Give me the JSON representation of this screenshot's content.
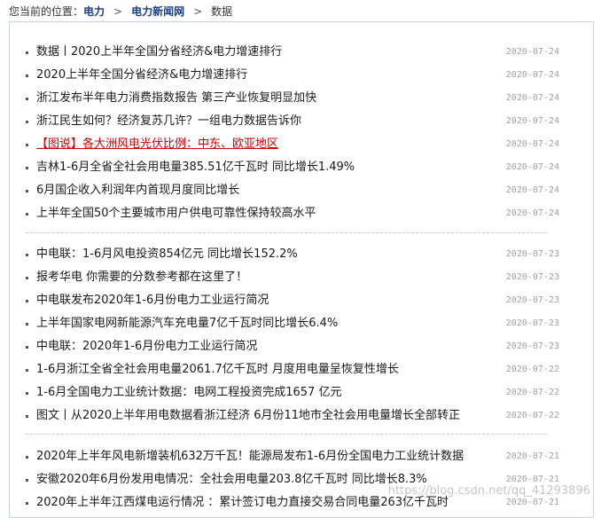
{
  "breadcrumb": {
    "prefix": "您当前的位置：",
    "items": [
      "电力",
      "电力新闻网"
    ],
    "current": "数据",
    "separator": ">"
  },
  "groups": [
    [
      {
        "title": "数据丨2020上半年全国分省经济&电力增速排行",
        "date": "2020-07-24"
      },
      {
        "title": "2020上半年全国分省经济&电力增速排行",
        "date": "2020-07-24"
      },
      {
        "title": "浙江发布半年电力消费指数报告 第三产业恢复明显加快",
        "date": "2020-07-24"
      },
      {
        "title": "浙江民生如何？经济复苏几许？一组电力数据告诉你",
        "date": "2020-07-24"
      },
      {
        "title": "【图说】各大洲风电光伏比例：中东、欧亚地区",
        "date": "2020-07-24",
        "highlight": true
      },
      {
        "title": "吉林1-6月全省全社会用电量385.51亿千瓦时 同比增长1.49%",
        "date": "2020-07-24"
      },
      {
        "title": "6月国企收入利润年内首现月度同比增长",
        "date": "2020-07-24"
      },
      {
        "title": "上半年全国50个主要城市用户供电可靠性保持较高水平",
        "date": "2020-07-24"
      }
    ],
    [
      {
        "title": "中电联：1-6月风电投资854亿元 同比增长152.2%",
        "date": "2020-07-23"
      },
      {
        "title": "报考华电 你需要的分数参考都在这里了！",
        "date": "2020-07-23"
      },
      {
        "title": "中电联发布2020年1-6月份电力工业运行简况",
        "date": "2020-07-23"
      },
      {
        "title": "上半年国家电网新能源汽车充电量7亿千瓦时同比增长6.4%",
        "date": "2020-07-23"
      },
      {
        "title": "中电联：2020年1-6月份电力工业运行简况",
        "date": "2020-07-23"
      },
      {
        "title": "1-6月浙江全省全社会用电量2061.7亿千瓦时 月度用电量呈恢复性增长",
        "date": "2020-07-22"
      },
      {
        "title": "1-6月全国电力工业统计数据：电网工程投资完成1657 亿元",
        "date": "2020-07-22"
      },
      {
        "title": "图文丨从2020上半年用电数据看浙江经济 6月份11地市全社会用电量增长全部转正",
        "date": "2020-07-22"
      }
    ],
    [
      {
        "title": "2020年上半年风电新增装机632万千瓦！能源局发布1-6月份全国电力工业统计数据",
        "date": "2020-07-21"
      },
      {
        "title": "安徽2020年6月份发用电情况：全社会用电量203.8亿千瓦时 同比增长8.3%",
        "date": "2020-07-21"
      },
      {
        "title": "2020年上半年江西煤电运行情况 ：累计签订电力直接交易合同电量263亿千瓦时",
        "date": "2020-07-21"
      }
    ]
  ],
  "watermark": "https://blog.csdn.net/qq_41293896",
  "colors": {
    "highlight": "#d10000",
    "link": "#1a3c8a",
    "date": "#a0a0a0",
    "border": "#c9d6e6"
  }
}
